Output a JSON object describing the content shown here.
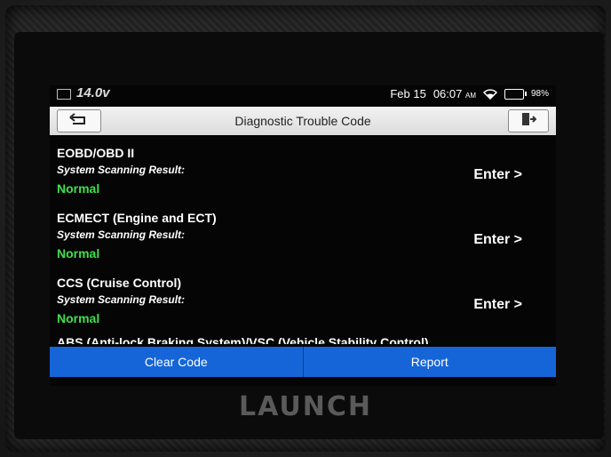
{
  "device": {
    "brand": "LAUNCH"
  },
  "status": {
    "voltage": "14.0v",
    "date": "Feb 15",
    "time": "06:07",
    "am_pm": "AM",
    "battery": "98%"
  },
  "titlebar": {
    "title": "Diagnostic Trouble Code"
  },
  "systems": [
    {
      "name": "EOBD/OBD II",
      "sub": "System Scanning Result:",
      "status": "Normal",
      "action": "Enter >"
    },
    {
      "name": "ECMECT (Engine and ECT)",
      "sub": "System Scanning Result:",
      "status": "Normal",
      "action": "Enter >"
    },
    {
      "name": "CCS (Cruise Control)",
      "sub": "System Scanning Result:",
      "status": "Normal",
      "action": "Enter >"
    }
  ],
  "partial_item": "ABS (Anti-lock Braking System)/VSC (Vehicle Stability Control)",
  "actions": {
    "clear_code": "Clear Code",
    "report": "Report"
  }
}
